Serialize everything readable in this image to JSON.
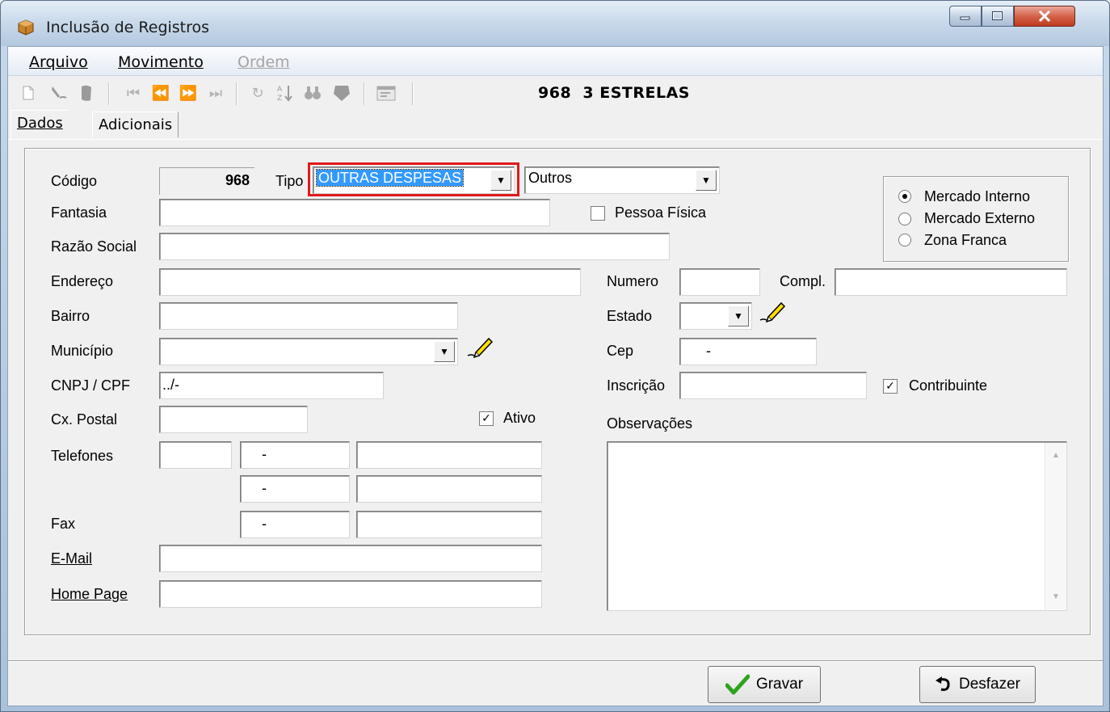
{
  "window": {
    "title": "Inclusão de Registros",
    "app_icon": "package-icon",
    "controls": {
      "minimize": "minimize-icon",
      "maximize": "maximize-icon",
      "close": "close-icon"
    }
  },
  "menubar": {
    "items": [
      {
        "label": "Arquivo",
        "enabled": true
      },
      {
        "label": "Movimento",
        "enabled": true
      },
      {
        "label": "Ordem",
        "enabled": false
      }
    ]
  },
  "toolbar": {
    "icons": [
      "new-document-icon",
      "edit-icon",
      "delete-icon",
      "first-record-icon",
      "previous-record-icon",
      "next-record-icon",
      "last-record-icon",
      "refresh-icon",
      "sort-az-icon",
      "find-icon",
      "filter-icon",
      "properties-icon"
    ],
    "record_code": "968",
    "record_name": "3 ESTRELAS"
  },
  "tabs": [
    {
      "label": "Dados",
      "active": true
    },
    {
      "label": "Adicionais",
      "active": false
    }
  ],
  "form": {
    "codigo": {
      "label": "Código",
      "value": "968"
    },
    "tipo": {
      "label": "Tipo",
      "value": "OUTRAS DESPESAS",
      "sub_value": "Outros"
    },
    "fantasia": {
      "label": "Fantasia",
      "value": ""
    },
    "pessoa_fisica": {
      "label": "Pessoa Física",
      "checked": false
    },
    "razao_social": {
      "label": "Razão Social",
      "value": ""
    },
    "endereco": {
      "label": "Endereço",
      "value": ""
    },
    "numero": {
      "label": "Numero",
      "value": ""
    },
    "compl": {
      "label": "Compl.",
      "value": ""
    },
    "bairro": {
      "label": "Bairro",
      "value": ""
    },
    "estado": {
      "label": "Estado",
      "value": ""
    },
    "municipio": {
      "label": "Município",
      "value": ""
    },
    "cep": {
      "label": "Cep",
      "value": "-"
    },
    "cnpj_cpf": {
      "label": "CNPJ / CPF",
      "value": "../-"
    },
    "inscricao": {
      "label": "Inscrição",
      "value": ""
    },
    "contribuinte": {
      "label": "Contribuinte",
      "checked": true
    },
    "cx_postal": {
      "label": "Cx. Postal",
      "value": ""
    },
    "ativo": {
      "label": "Ativo",
      "checked": true
    },
    "observacoes": {
      "label": "Observações",
      "value": ""
    },
    "telefones": {
      "label": "Telefones",
      "ddd": "",
      "phone1": "-",
      "phone2": "-"
    },
    "fax": {
      "label": "Fax",
      "value": "-"
    },
    "email": {
      "label": "E-Mail",
      "value": ""
    },
    "home_page": {
      "label": "Home Page",
      "value": ""
    },
    "mercado": {
      "options": [
        "Mercado Interno",
        "Mercado Externo",
        "Zona Franca"
      ],
      "selected": "Mercado Interno"
    }
  },
  "buttons": {
    "gravar": "Gravar",
    "desfazer": "Desfazer"
  },
  "colors": {
    "highlight": "#e01a1a",
    "selection": "#3399ff"
  }
}
